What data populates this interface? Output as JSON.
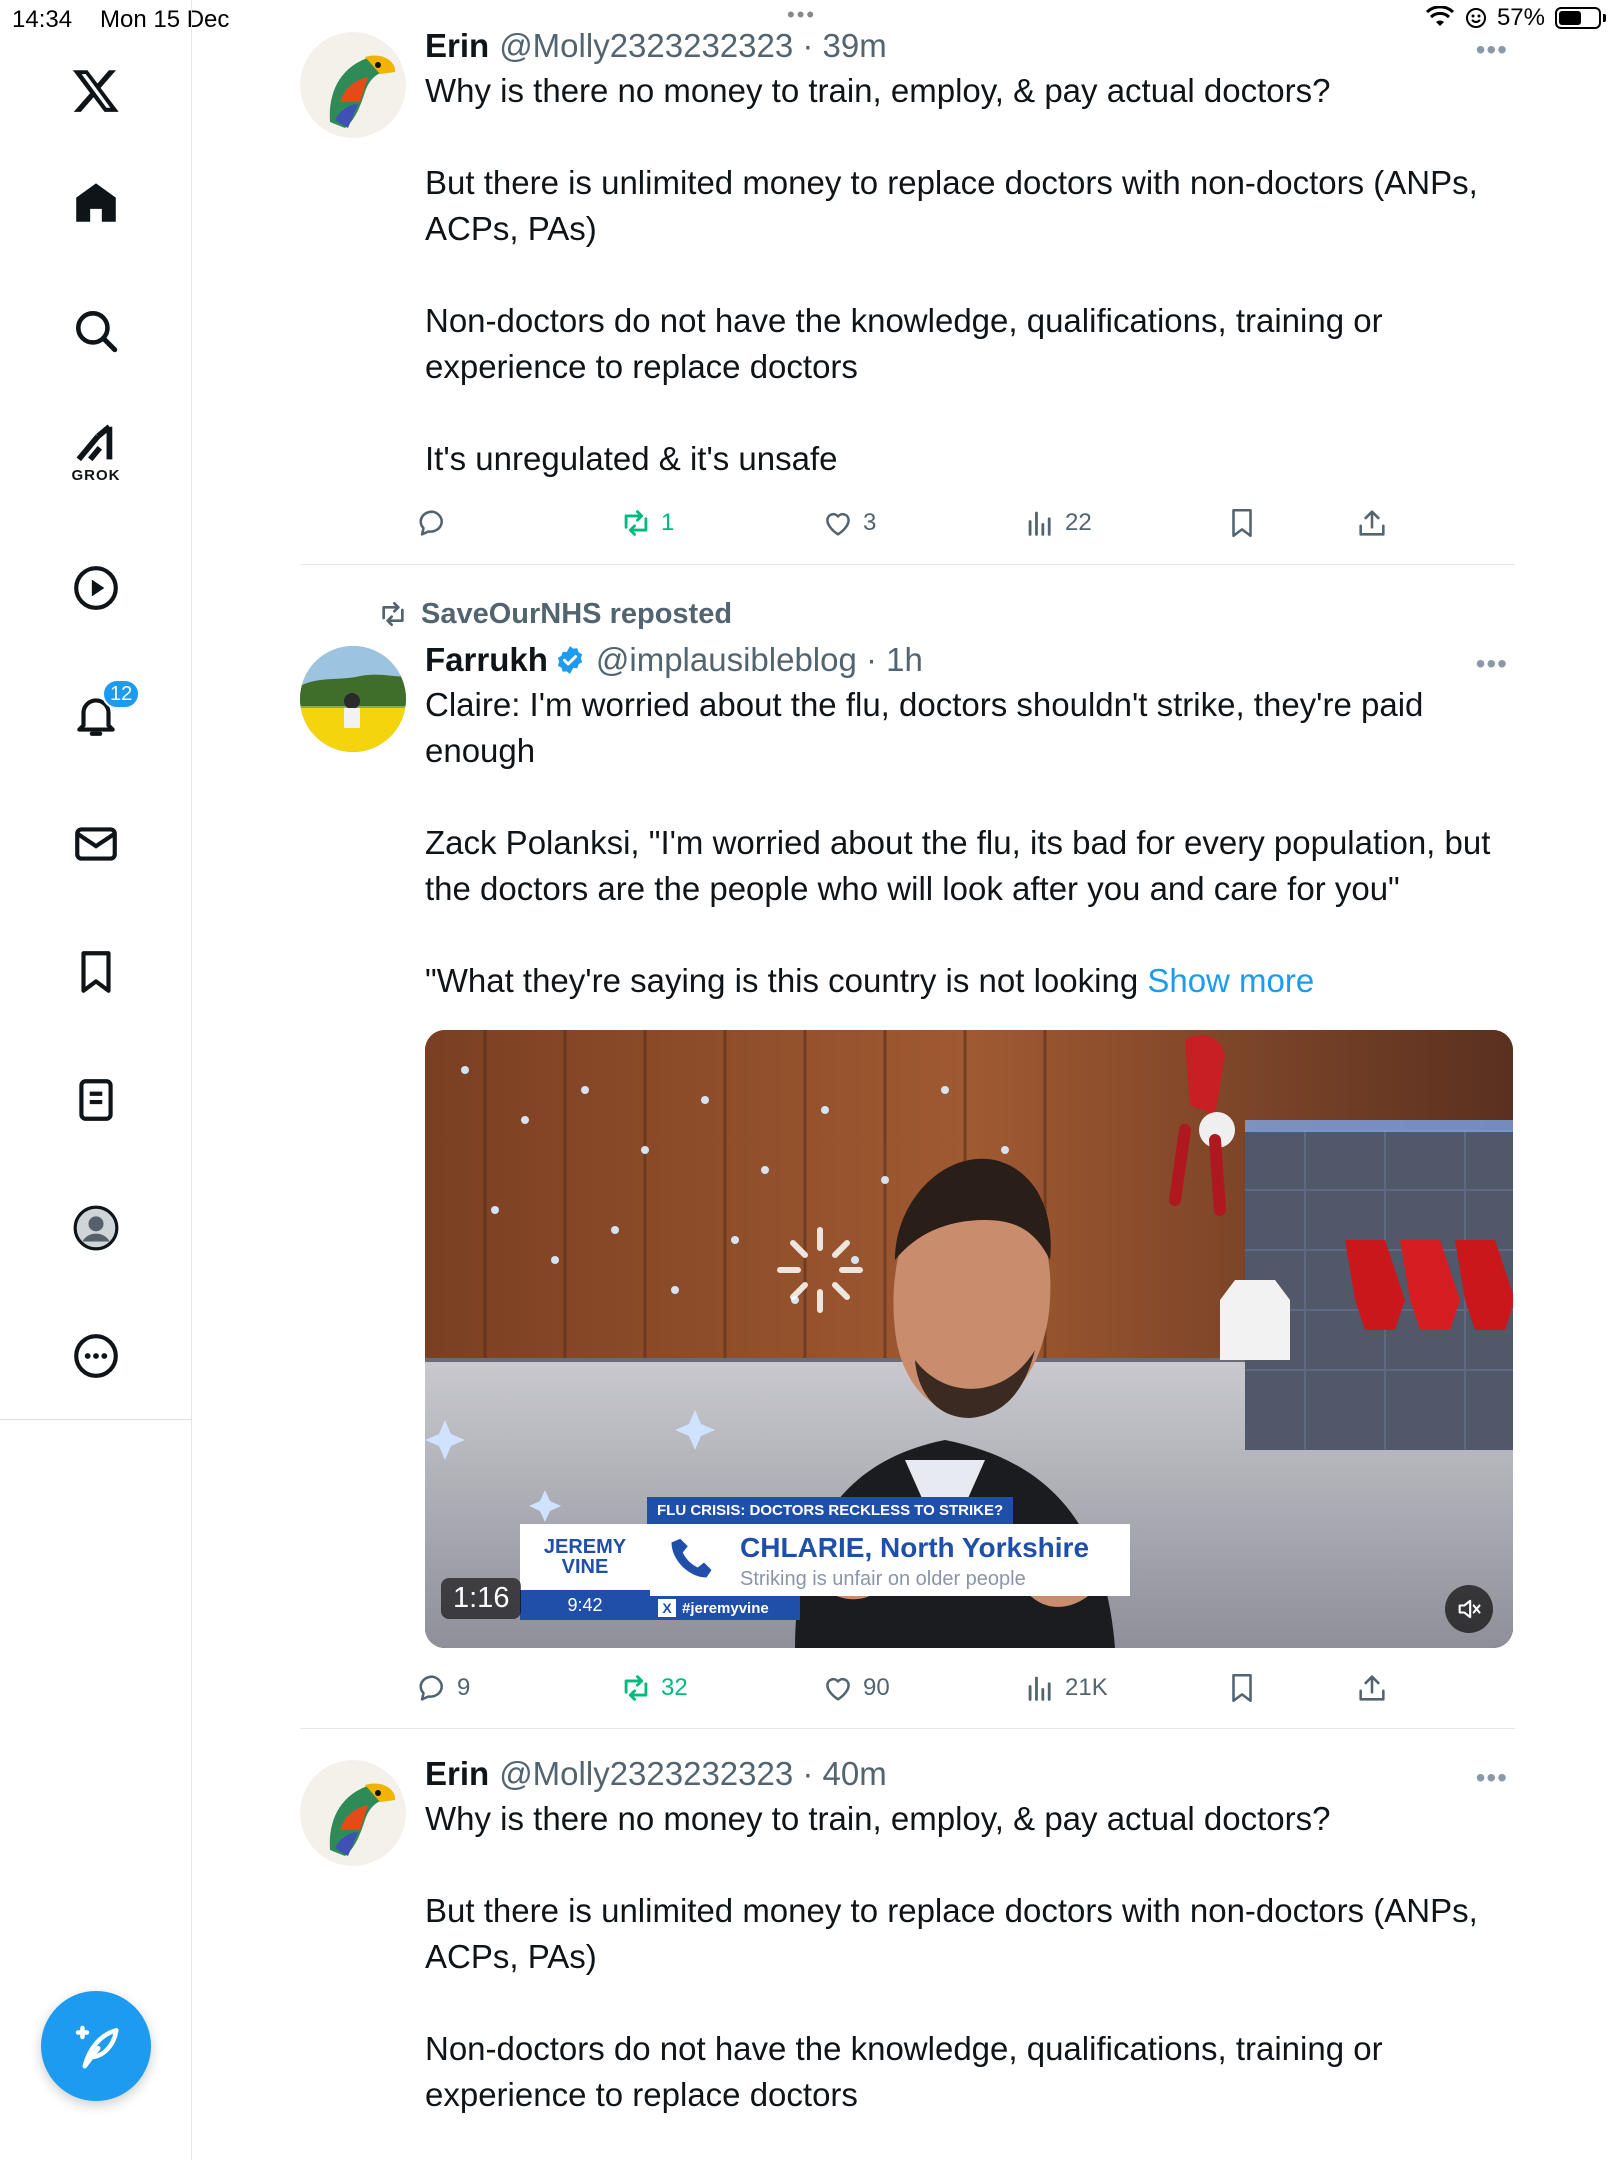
{
  "status_bar": {
    "time": "14:34",
    "date": "Mon 15 Dec",
    "battery": "57%",
    "battery_level": 0.57
  },
  "sidebar": {
    "grok_label": "GROK",
    "notification_count": "12"
  },
  "posts": [
    {
      "author": "Erin",
      "meta": "@Molly2323232323 · 39m",
      "text": "Why is there no money to train, employ, & pay actual doctors?\n\nBut there is unlimited money to replace doctors with non-doctors (ANPs, ACPs, PAs)\n\nNon-doctors do not have the knowledge, qualifications, training or experience to replace doctors\n\nIt's unregulated & it's unsafe",
      "replies": "",
      "reposts": "1",
      "likes": "3",
      "views": "22"
    },
    {
      "reposted_by": "SaveOurNHS reposted",
      "author": "Farrukh",
      "meta": "@implausibleblog · 1h",
      "text": "Claire: I'm worried about the flu, doctors shouldn't strike, they're paid enough\n\nZack Polanksi, \"I'm worried about the flu, its bad for every population, but the doctors are the people who will look after you and care for you\"\n\n\"What they're saying is this country is not looking ",
      "show_more": "Show more",
      "media": {
        "duration": "1:16",
        "tag": "FLU CRISIS: DOCTORS RECKLESS TO STRIKE?",
        "show_logo": "JEREMY VINE",
        "clock": "9:42",
        "caller": "CHLARIE, North Yorkshire",
        "caller_sub": "Striking is unfair on older people",
        "hashtag": "#jeremyvine"
      },
      "replies": "9",
      "reposts": "32",
      "likes": "90",
      "views": "21K"
    },
    {
      "author": "Erin",
      "meta": "@Molly2323232323 · 40m",
      "text": "Why is there no money to train, employ, & pay actual doctors?\n\nBut there is unlimited money to replace doctors with non-doctors (ANPs, ACPs, PAs)\n\nNon-doctors do not have the knowledge, qualifications, training or experience to replace doctors"
    }
  ],
  "colors": {
    "accent": "#1d9bf0",
    "repost_green": "#00ba7c",
    "secondary_text": "#536471"
  }
}
